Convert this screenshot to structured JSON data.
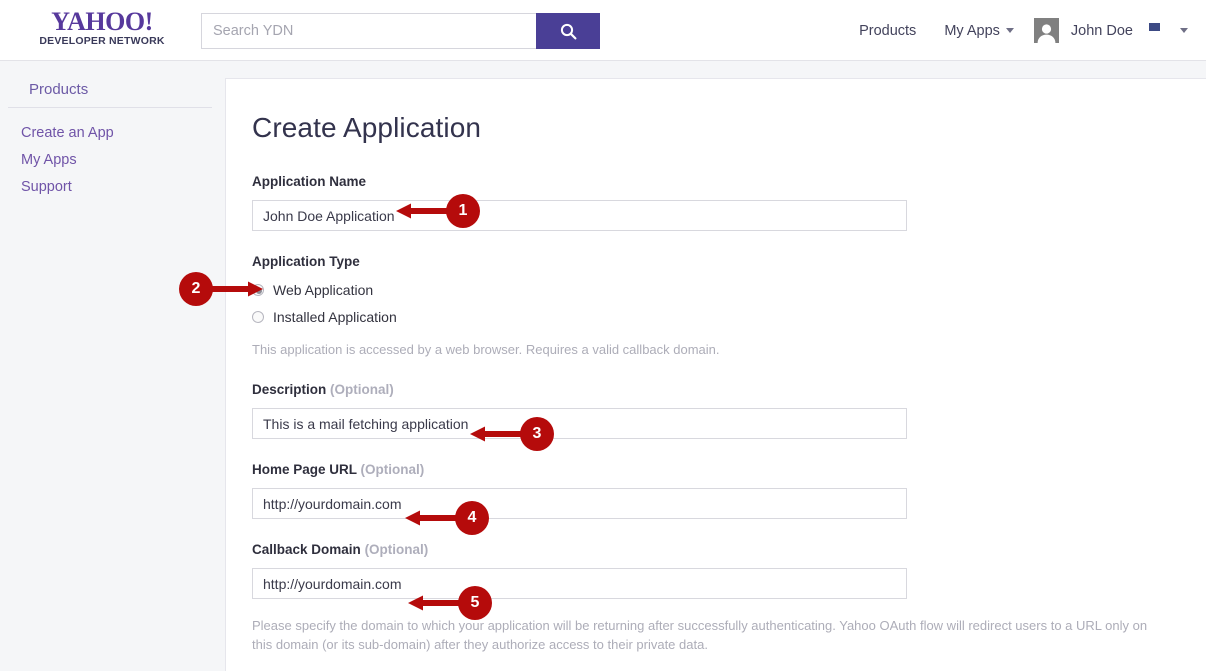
{
  "header": {
    "logo_main": "YAHOO!",
    "logo_sub": "DEVELOPER NETWORK",
    "search": {
      "placeholder": "Search YDN",
      "value": "",
      "button_icon": "search-icon"
    },
    "nav": [
      {
        "label": "Products",
        "has_caret": false
      },
      {
        "label": "My Apps",
        "has_caret": true
      }
    ],
    "user": {
      "name": "John Doe",
      "avatar_icon": "user-avatar-icon"
    },
    "locale": {
      "flag_icon": "us-flag-icon",
      "has_caret": true
    }
  },
  "sidebar": {
    "heading": "Products",
    "items": [
      {
        "label": "Create an App"
      },
      {
        "label": "My Apps"
      },
      {
        "label": "Support"
      }
    ]
  },
  "main": {
    "title": "Create Application",
    "fields": {
      "app_name": {
        "label": "Application Name",
        "optional": "",
        "value": "John Doe Application",
        "placeholder": ""
      },
      "app_type": {
        "label": "Application Type",
        "options": [
          {
            "label": "Web Application",
            "selected": true
          },
          {
            "label": "Installed Application",
            "selected": false
          }
        ],
        "help": "This application is accessed by a web browser. Requires a valid callback domain."
      },
      "description": {
        "label": "Description",
        "optional": "(Optional)",
        "value": "This is a mail fetching application",
        "placeholder": ""
      },
      "home_page_url": {
        "label": "Home Page URL",
        "optional": "(Optional)",
        "value": "http://yourdomain.com",
        "placeholder": ""
      },
      "callback_domain": {
        "label": "Callback Domain",
        "optional": "(Optional)",
        "value": "http://yourdomain.com",
        "placeholder": "",
        "help": "Please specify the domain to which your application will be returning after successfully authenticating. Yahoo OAuth flow will redirect users to a URL only on this domain (or its sub-domain) after they authorize access to their private data."
      }
    }
  },
  "annotations": {
    "color": "#b50b0b",
    "markers": [
      {
        "number": "1",
        "direction": "left"
      },
      {
        "number": "2",
        "direction": "right"
      },
      {
        "number": "3",
        "direction": "left"
      },
      {
        "number": "4",
        "direction": "left"
      },
      {
        "number": "5",
        "direction": "left"
      }
    ]
  }
}
